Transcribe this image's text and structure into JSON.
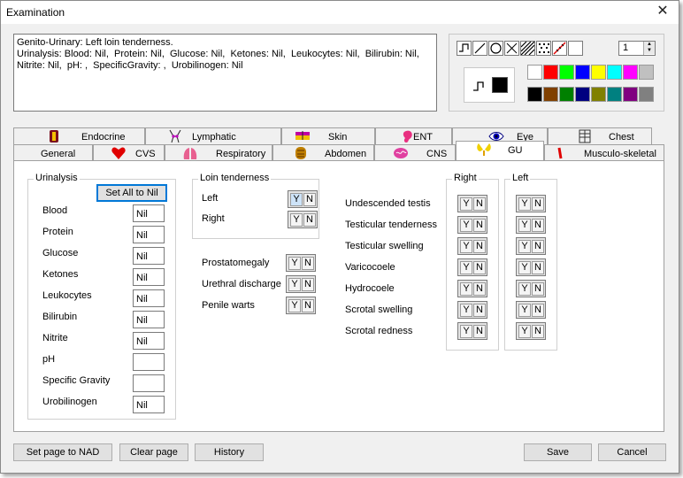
{
  "window": {
    "title": "Examination",
    "close_symbol": "✕"
  },
  "notes": {
    "text": "Genito-Urinary: Left loin tenderness.\nUrinalysis: Blood: Nil,  Protein: Nil,  Glucose: Nil,  Ketones: Nil,  Leukocytes: Nil,  Bilirubin: Nil,  Nitrite: Nil,  pH: ,  SpecificGravity: ,  Urobilinogen: Nil"
  },
  "drawing": {
    "tools": [
      "curve-tool-icon",
      "line-tool-icon",
      "circle-tool-icon",
      "cross-tool-icon",
      "hatch-tool-icon",
      "dots-tool-icon",
      "red-line-tool-icon",
      "blank-tool-icon"
    ],
    "pen_size": "1",
    "current_color": "#000000",
    "palette": [
      "#ffffff",
      "#ff0000",
      "#00ff00",
      "#0000ff",
      "#ffff00",
      "#00ffff",
      "#ff00ff",
      "#c0c0c0",
      "#000000",
      "#804000",
      "#008000",
      "#000080",
      "#808000",
      "#008080",
      "#800080",
      "#808080"
    ]
  },
  "tabs": {
    "row1": [
      {
        "label": "Endocrine",
        "icon": "thyroid-icon"
      },
      {
        "label": "Lymphatic",
        "icon": "lymph-icon"
      },
      {
        "label": "Skin",
        "icon": "skin-icon"
      },
      {
        "label": "ENT",
        "icon": "ear-icon"
      },
      {
        "label": "Eye",
        "icon": "eye-icon"
      },
      {
        "label": "Chest",
        "icon": "chest-icon"
      }
    ],
    "row2": [
      {
        "label": "General",
        "icon": ""
      },
      {
        "label": "CVS",
        "icon": "heart-icon"
      },
      {
        "label": "Respiratory",
        "icon": "lungs-icon"
      },
      {
        "label": "Abdomen",
        "icon": "abdomen-icon"
      },
      {
        "label": "CNS",
        "icon": "brain-icon"
      },
      {
        "label": "GU",
        "icon": "kidney-icon"
      },
      {
        "label": "Musculo-skeletal",
        "icon": "bone-icon"
      }
    ],
    "active": "GU"
  },
  "urinalysis": {
    "title": "Urinalysis",
    "set_all_label": "Set All to Nil",
    "rows": [
      {
        "label": "Blood",
        "value": "Nil"
      },
      {
        "label": "Protein",
        "value": "Nil"
      },
      {
        "label": "Glucose",
        "value": "Nil"
      },
      {
        "label": "Ketones",
        "value": "Nil"
      },
      {
        "label": "Leukocytes",
        "value": "Nil"
      },
      {
        "label": "Bilirubin",
        "value": "Nil"
      },
      {
        "label": "Nitrite",
        "value": "Nil"
      },
      {
        "label": "pH",
        "value": ""
      },
      {
        "label": "Specific Gravity",
        "value": ""
      },
      {
        "label": "Urobilinogen",
        "value": "Nil"
      }
    ]
  },
  "loin": {
    "title": "Loin tenderness",
    "rows": [
      {
        "label": "Left",
        "selected": "Y"
      },
      {
        "label": "Right",
        "selected": ""
      }
    ]
  },
  "other": [
    {
      "label": "Prostatomegaly"
    },
    {
      "label": "Urethral discharge"
    },
    {
      "label": "Penile warts"
    }
  ],
  "scrotal": {
    "right_title": "Right",
    "left_title": "Left",
    "rows": [
      {
        "label": "Undescended testis"
      },
      {
        "label": "Testicular tenderness"
      },
      {
        "label": "Testicular swelling"
      },
      {
        "label": "Varicocoele"
      },
      {
        "label": "Hydrocoele"
      },
      {
        "label": "Scrotal swelling"
      },
      {
        "label": "Scrotal redness"
      }
    ]
  },
  "yn": {
    "y": "Y",
    "n": "N"
  },
  "buttons": {
    "set_nad": "Set page to NAD",
    "clear": "Clear page",
    "history": "History",
    "save": "Save",
    "cancel": "Cancel"
  }
}
